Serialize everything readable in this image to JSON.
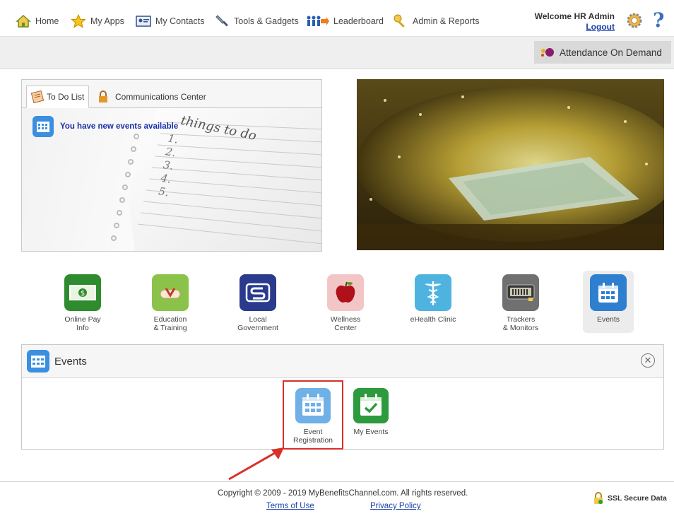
{
  "nav": {
    "items": [
      {
        "label": "Home",
        "icon": "home-icon"
      },
      {
        "label": "My Apps",
        "icon": "star-icon"
      },
      {
        "label": "My Contacts",
        "icon": "contact-card-icon"
      },
      {
        "label": "Tools & Gadgets",
        "icon": "tools-icon"
      },
      {
        "label": "Leaderboard",
        "icon": "leaderboard-icon"
      },
      {
        "label": "Admin & Reports",
        "icon": "key-icon"
      }
    ],
    "welcome": "Welcome HR Admin",
    "logout": "Logout",
    "help": "?"
  },
  "subbar": {
    "attendance": "Attendance On Demand"
  },
  "todo": {
    "tabs": [
      "To Do List",
      "Communications Center"
    ],
    "notice": "You have new events available",
    "handwriting": "things to do",
    "list_numbers": [
      "1.",
      "2.",
      "3.",
      "4.",
      "5."
    ]
  },
  "apps": [
    {
      "label1": "Online Pay",
      "label2": "Info",
      "color": "#2e8b2e"
    },
    {
      "label1": "Education",
      "label2": "& Training",
      "color": "#8bc34a"
    },
    {
      "label1": "Local",
      "label2": "Government",
      "color": "#2a3a8c"
    },
    {
      "label1": "Wellness",
      "label2": "Center",
      "color": "#f3c6c6"
    },
    {
      "label1": "eHealth Clinic",
      "label2": "",
      "color": "#4fb3e0"
    },
    {
      "label1": "Trackers",
      "label2": "& Monitors",
      "color": "#707070"
    },
    {
      "label1": "Events",
      "label2": "",
      "color": "#2f7fd0"
    }
  ],
  "events_panel": {
    "title": "Events",
    "close": "✕",
    "items": [
      {
        "label1": "Event",
        "label2": "Registration"
      },
      {
        "label1": "My Events",
        "label2": ""
      }
    ]
  },
  "footer": {
    "copyright": "Copyright © 2009 - 2019 MyBenefitsChannel.com. All rights reserved.",
    "terms": "Terms of Use",
    "privacy": "Privacy Policy",
    "ssl": "SSL Secure Data"
  },
  "colors": {
    "link": "#1a3fa6",
    "highlight": "#d9302a"
  }
}
